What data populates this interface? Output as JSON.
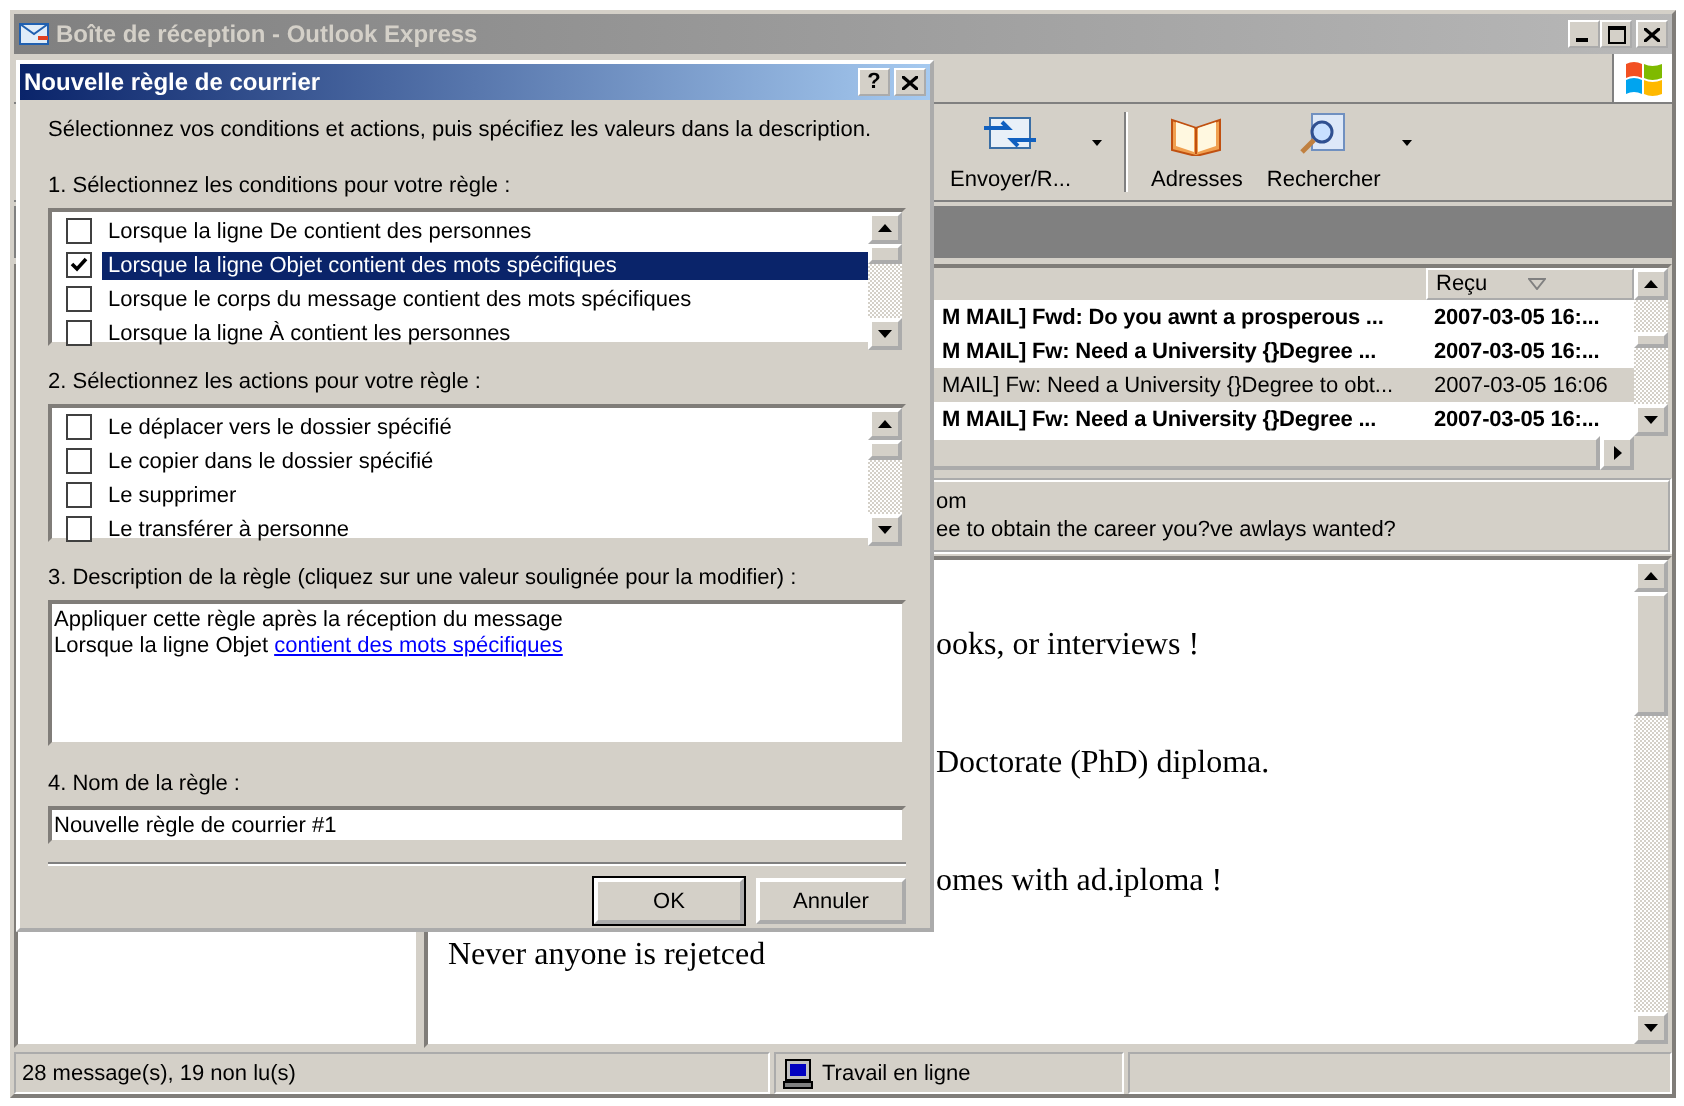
{
  "window": {
    "title": "Boîte de réception - Outlook Express"
  },
  "toolbar": {
    "buttons": [
      {
        "label": "Envoyer/R...",
        "kind": "send-receive",
        "dropdown": true
      },
      {
        "label": "Adresses",
        "kind": "addresses",
        "dropdown": false
      },
      {
        "label": "Rechercher",
        "kind": "find",
        "dropdown": true
      }
    ]
  },
  "message_list": {
    "columns": [
      {
        "label": "Reçu",
        "sorted": true
      }
    ],
    "rows": [
      {
        "subject": "M MAIL] Fwd:  Do you awnt a prosperous ...",
        "received": "2007-03-05 16:...",
        "unread": true,
        "selected": false
      },
      {
        "subject": "M MAIL] Fw: Need a University {}Degree ...",
        "received": "2007-03-05 16:...",
        "unread": true,
        "selected": false
      },
      {
        "subject": "MAIL] Fw: Need a University {}Degree to obt...",
        "received": "2007-03-05 16:06",
        "unread": false,
        "selected": true
      },
      {
        "subject": "M MAIL] Fw: Need a University {}Degree ...",
        "received": "2007-03-05 16:...",
        "unread": true,
        "selected": false
      }
    ]
  },
  "preview": {
    "header_lines": [
      "om",
      "ee to obtain the career you?ve awlays wanted?"
    ],
    "body": [
      {
        "text": "ooks, or interviews !",
        "kind": "partial"
      },
      {
        "text": "Doctorate (PhD) diploma.",
        "kind": "partial"
      },
      {
        "text": "omes with ad.iploma !",
        "kind": "partial"
      },
      {
        "text": "Never anyone is rejetced",
        "kind": "full"
      }
    ]
  },
  "status_bar": {
    "messages": "28 message(s), 19 non lu(s)",
    "connection": "Travail en ligne"
  },
  "dialog": {
    "title": "Nouvelle règle de courrier",
    "help_button": "?",
    "intro": "Sélectionnez vos conditions et actions, puis spécifiez les valeurs dans la description.",
    "conditions": {
      "label": "1. Sélectionnez les conditions pour votre règle :",
      "items": [
        {
          "label": "Lorsque la ligne De contient des personnes",
          "checked": false,
          "selected": false
        },
        {
          "label": "Lorsque la ligne Objet contient des mots spécifiques",
          "checked": true,
          "selected": true
        },
        {
          "label": "Lorsque le corps du message contient des mots spécifiques",
          "checked": false,
          "selected": false
        },
        {
          "label": "Lorsque la ligne À contient les personnes",
          "checked": false,
          "selected": false
        }
      ]
    },
    "actions": {
      "label": "2. Sélectionnez les actions pour votre règle :",
      "items": [
        {
          "label": "Le déplacer vers le dossier spécifié",
          "checked": false,
          "selected": false
        },
        {
          "label": "Le copier dans le dossier spécifié",
          "checked": false,
          "selected": false
        },
        {
          "label": "Le supprimer",
          "checked": false,
          "selected": false
        },
        {
          "label": "Le transférer à personne",
          "checked": false,
          "selected": false
        }
      ]
    },
    "description": {
      "label": "3. Description de la règle (cliquez sur une valeur soulignée pour la modifier) :",
      "lines": [
        {
          "text": "Appliquer cette règle après la réception du message"
        },
        {
          "text": "Lorsque la ligne Objet",
          "link": "contient des mots spécifiques"
        }
      ]
    },
    "rule_name": {
      "label": "4. Nom de la règle :",
      "value": "Nouvelle règle de courrier #1"
    },
    "buttons": [
      {
        "label": "OK",
        "default": true
      },
      {
        "label": "Annuler",
        "default": false
      }
    ]
  }
}
